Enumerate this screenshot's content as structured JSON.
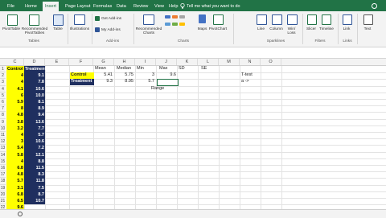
{
  "ribbon": {
    "tabs": [
      "File",
      "Home",
      "Insert",
      "Page Layout",
      "Formulas",
      "Data",
      "Review",
      "View",
      "Help",
      "Power Pivot"
    ],
    "active_tab": "Insert",
    "tell_me": "Tell me what you want to do",
    "buttons": {
      "pivottable": "PivotTable",
      "recommended_pivottables": "Recommended PivotTables",
      "table": "Table",
      "illustrations": "Illustrations",
      "get_addins": "Get Add-ins",
      "my_addins": "My Add-ins",
      "recommended_charts": "Recommended Charts",
      "maps": "Maps",
      "pivotchart": "PivotChart",
      "line": "Line",
      "column": "Column",
      "win_loss": "Win/ Loss",
      "slicer": "Slicer",
      "timeline": "Timeline",
      "link": "Link",
      "text": "Text"
    },
    "groups": [
      "Tables",
      "Add-ins",
      "Charts",
      "Sparklines",
      "Filters",
      "Links"
    ]
  },
  "grid": {
    "columns": [
      "C",
      "D",
      "E",
      "F",
      "G",
      "H",
      "I",
      "J",
      "K",
      "L",
      "M",
      "N",
      "O"
    ],
    "rows": [
      "1",
      "2",
      "3",
      "4",
      "5",
      "6",
      "7",
      "8",
      "9",
      "10",
      "11",
      "12",
      "13",
      "14",
      "15",
      "16",
      "17",
      "18",
      "19",
      "20",
      "21",
      "22"
    ],
    "headers": {
      "control": "Control",
      "treatment": "Treatment"
    },
    "control": [
      "4",
      "4",
      "4.1",
      "6",
      "5.9",
      "8",
      "4.8",
      "3.8",
      "3.2",
      "4",
      "3",
      "5.4",
      "5.8",
      "4",
      "6.8",
      "4.8",
      "5.7",
      "3.1",
      "6.8",
      "6.5",
      "9.6"
    ],
    "treatment": [
      "9.1",
      "7.8",
      "10.6",
      "10.0",
      "8.1",
      "8.9",
      "9.4",
      "13.6",
      "7.7",
      "5.7",
      "10.6",
      "7.2",
      "12.1",
      "8.8",
      "11.5",
      "8.3",
      "11.8",
      "7.5",
      "8.7",
      "10.7"
    ],
    "stats_headers": {
      "mean": "Mean",
      "median": "Median",
      "min": "Min",
      "max": "Max",
      "sd": "SD",
      "se": "SE"
    },
    "stats_rows": [
      {
        "label": "Control",
        "mean": "5.41",
        "median": "5.75",
        "min": "3",
        "max": "9.6"
      },
      {
        "label": "Treatment",
        "mean": "9.3",
        "median": "8.95",
        "min": "5.7"
      }
    ],
    "range_label": "Range",
    "ttest_label": "T-test",
    "alpha_label": "a ->"
  },
  "colors": {
    "excel_green": "#217346",
    "highlight_yellow": "#ffff00",
    "header_navy": "#1f2f5f"
  }
}
